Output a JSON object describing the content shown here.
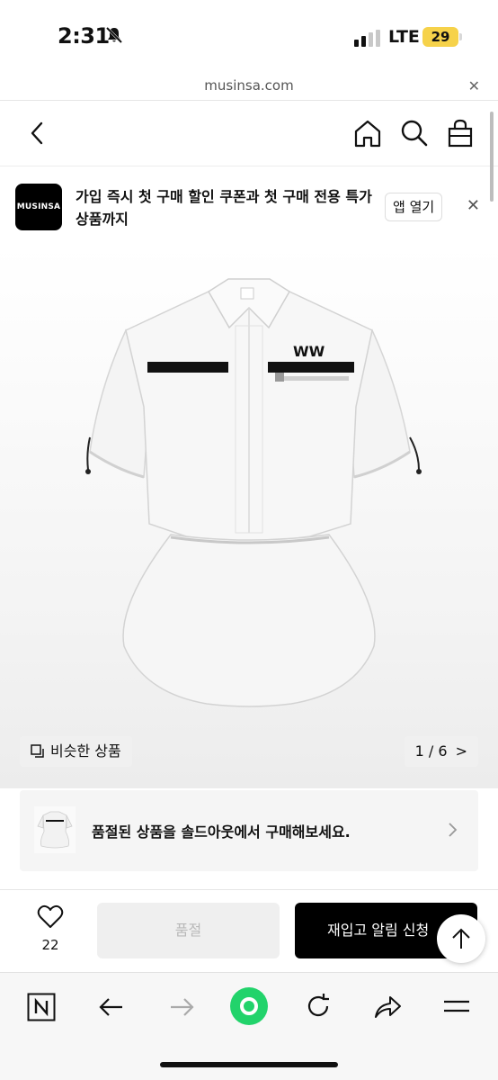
{
  "status_bar": {
    "time": "2:31",
    "network": "LTE",
    "battery": "29"
  },
  "browser": {
    "url": "musinsa.com"
  },
  "promo": {
    "logo_text": "MUSINSA",
    "text": "가입 즉시 첫 구매 할인 쿠폰과 첫 구매 전용 특가 상품까지",
    "button": "앱 열기"
  },
  "product": {
    "similar_label": "비슷한 상품",
    "pager": "1 / 6",
    "pager_arrow": ">"
  },
  "soldout_banner": {
    "text": "품절된 상품을 솔드아웃에서 구매해보세요."
  },
  "purchase": {
    "like_count": "22",
    "soldout_label": "품절",
    "restock_label": "재입고 알림 신청"
  },
  "colors": {
    "accent": "#000000",
    "toolbar_green": "#22d36b",
    "battery": "#f6d24a"
  },
  "icons": [
    "bell-off-icon",
    "close-icon",
    "back-icon",
    "home-icon",
    "search-icon",
    "bag-icon",
    "similar-icon",
    "chevron-right-icon",
    "heart-icon",
    "arrow-up-icon",
    "naver-n-icon",
    "arrow-left-icon",
    "arrow-right-icon",
    "refresh-icon",
    "share-icon",
    "menu-icon"
  ]
}
